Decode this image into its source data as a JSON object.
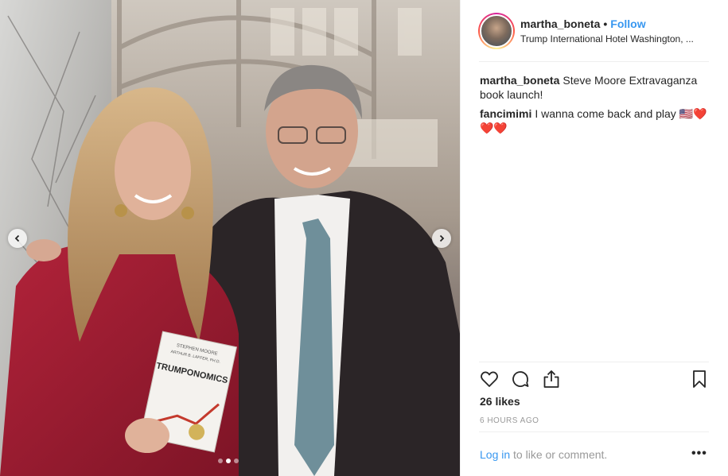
{
  "post": {
    "username": "martha_boneta",
    "separator": "•",
    "follow_label": "Follow",
    "location": "Trump International Hotel Washington, ..."
  },
  "comments": [
    {
      "user": "martha_boneta",
      "text": "Steve Moore Extravaganza book launch!"
    },
    {
      "user": "fancimimi",
      "text": "I wanna come back and play 🇺🇸❤️❤️❤️"
    }
  ],
  "engagement": {
    "likes": "26 likes",
    "timestamp": "6 HOURS AGO"
  },
  "footer": {
    "login_link": "Log in",
    "login_rest": " to like or comment.",
    "more_label": "•••"
  },
  "book": {
    "authors_line1": "STEPHEN MOORE",
    "authors_line2": "ARTHUR B. LAFFER, PH.D.",
    "title": "TRUMPONOMICS"
  },
  "carousel": {
    "slide_count": 3,
    "active_slide": 2
  },
  "icons": {
    "prev": "chevron-left-icon",
    "next": "chevron-right-icon",
    "like": "heart-icon",
    "comment": "comment-bubble-icon",
    "share": "share-icon",
    "save": "bookmark-icon"
  },
  "colors": {
    "link_blue": "#3897f0",
    "meta_gray": "#999999",
    "text": "#262626"
  }
}
